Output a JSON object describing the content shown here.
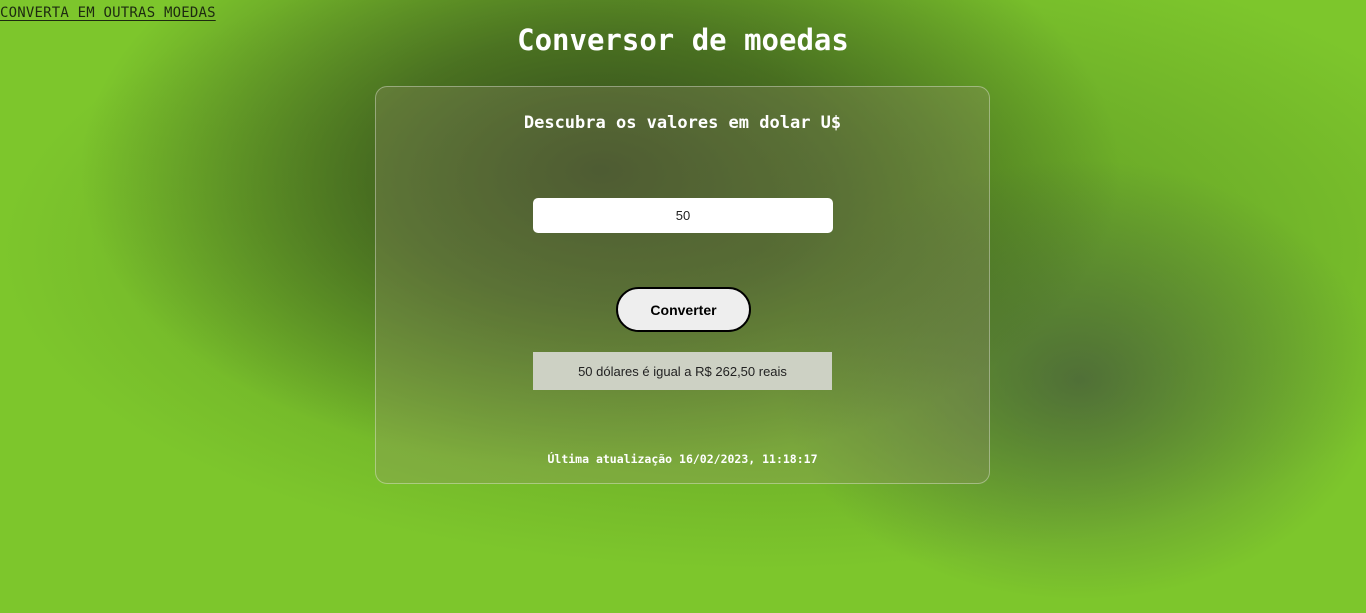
{
  "nav": {
    "other_currencies_link": "CONVERTA EM OUTRAS MOEDAS"
  },
  "header": {
    "title": "Conversor de moedas"
  },
  "converter": {
    "subtitle": "Descubra os valores em dolar U$",
    "amount_value": "50",
    "convert_button_label": "Converter",
    "result_text": "50 dólares é igual a R$ 262,50 reais",
    "last_update_text": "Última atualização 16/02/2023, 11:18:17"
  },
  "colors": {
    "background_accent": "#7dc62c",
    "result_background": "#cdd1c4",
    "button_background": "#eeeeee"
  }
}
